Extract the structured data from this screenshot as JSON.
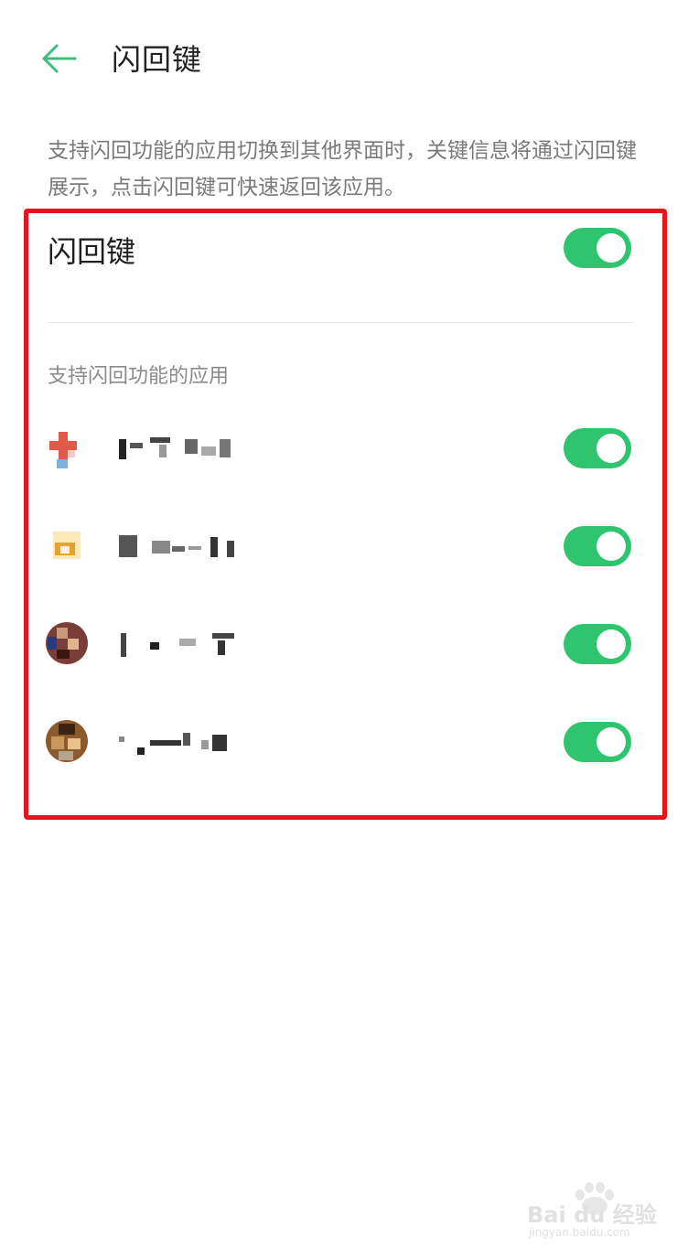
{
  "header": {
    "title": "闪回键",
    "back_icon": "arrow-left-icon"
  },
  "description": "支持闪回功能的应用切换到其他界面时，关键信息将通过闪回键展示，点击闪回键可快速返回该应用。",
  "main_toggle": {
    "label": "闪回键",
    "on": true
  },
  "apps_section": {
    "title": "支持闪回功能的应用",
    "apps": [
      {
        "name": "",
        "on": true
      },
      {
        "name": "",
        "on": true
      },
      {
        "name": "",
        "on": true
      },
      {
        "name": "",
        "on": true
      }
    ]
  },
  "colors": {
    "accent": "#2ec56e",
    "back_arrow": "#3dbf7a",
    "highlight": "#e8141c"
  },
  "watermark": {
    "brand": "Bai du 经验",
    "url": "jingyan.baidu.com"
  }
}
